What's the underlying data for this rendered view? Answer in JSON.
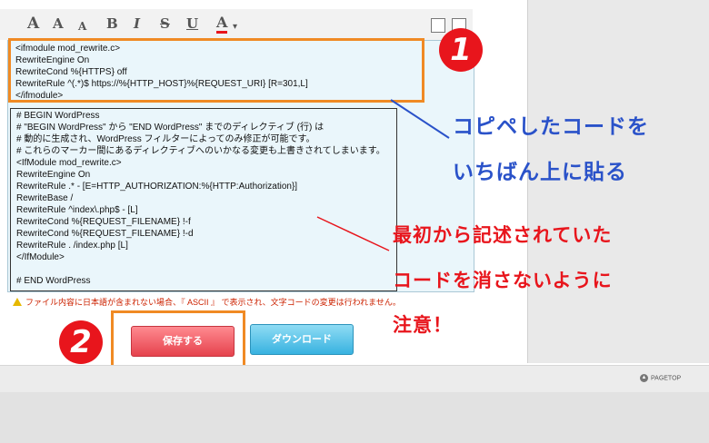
{
  "toolbar": {
    "buttons": [
      {
        "label": "A",
        "name": "font-large"
      },
      {
        "label": "A",
        "name": "font-medium"
      },
      {
        "label": "A",
        "name": "font-small"
      },
      {
        "label": "B",
        "name": "bold"
      },
      {
        "label": "I",
        "name": "italic"
      },
      {
        "label": "S",
        "name": "strikethrough"
      },
      {
        "label": "U",
        "name": "underline"
      },
      {
        "label": "A",
        "name": "font-color"
      }
    ],
    "dropdown_arrow": "▾"
  },
  "editor": {
    "top_lines": [
      "<ifmodule mod_rewrite.c>",
      "RewriteEngine On",
      "RewriteCond %{HTTPS} off",
      "RewriteRule ^(.*)$ https://%{HTTP_HOST}%{REQUEST_URI} [R=301,L]",
      "</ifmodule>"
    ],
    "bottom_lines": [
      "# BEGIN WordPress",
      "# \"BEGIN WordPress\" から \"END WordPress\" までのディレクティブ (行) は",
      "# 動的に生成され、WordPress フィルターによってのみ修正が可能です。",
      "# これらのマーカー間にあるディレクティブへのいかなる変更も上書きされてしまいます。",
      "<IfModule mod_rewrite.c>",
      "RewriteEngine On",
      "RewriteRule .* - [E=HTTP_AUTHORIZATION:%{HTTP:Authorization}]",
      "RewriteBase /",
      "RewriteRule ^index\\.php$ - [L]",
      "RewriteCond %{REQUEST_FILENAME} !-f",
      "RewriteCond %{REQUEST_FILENAME} !-d",
      "RewriteRule . /index.php [L]",
      "</IfModule>",
      "",
      "# END WordPress"
    ]
  },
  "warning": "ファイル内容に日本語が含まれない場合、『 ASCII 』 で表示され、文字コードの変更は行われません。",
  "buttons": {
    "save": "保存する",
    "download": "ダウンロード"
  },
  "annotations": {
    "step1": "1",
    "step2": "2",
    "paste_line1": "コピペしたコードを",
    "paste_line2": "いちばん上に貼る",
    "caution_line1": "最初から記述されていた",
    "caution_line2": "コードを消さないように",
    "caution_line3": "注意！"
  },
  "footer": {
    "pagetop": "PAGETOP"
  },
  "colors": {
    "highlight": "#f08a24",
    "annotation_red": "#e8151c",
    "annotation_blue": "#2a52c9",
    "save_button": "#e5424d",
    "download_button": "#38b2e0"
  }
}
